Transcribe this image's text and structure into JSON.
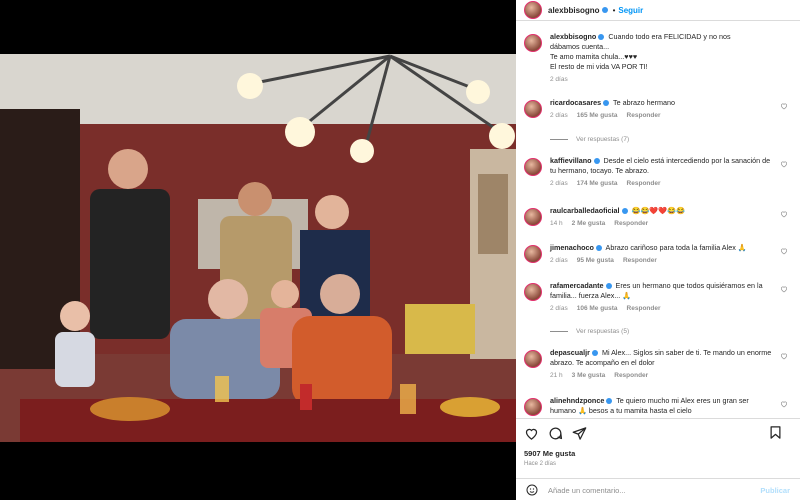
{
  "post": {
    "username": "alexbbisogno",
    "follow_label": "Seguir",
    "separator": "•"
  },
  "caption": {
    "username": "alexbbisogno",
    "text_1": "Cuando todo era FELICIDAD y no nos",
    "text_2": "dábamos cuenta...",
    "text_3": "Te amo mamita chula...♥♥♥",
    "text_4": "El resto de mi vida VA POR TI!",
    "time": "2 días"
  },
  "comments": [
    {
      "username": "ricardocasares",
      "text": "Te abrazo hermano",
      "time": "2 días",
      "likes": "165 Me gusta",
      "reply": "Responder",
      "replies": "Ver respuestas (7)"
    },
    {
      "username": "kaffievillano",
      "text": "Desde el cielo está intercediendo por la sanación de tu hermano, tocayo. Te abrazo.",
      "time": "2 días",
      "likes": "174 Me gusta",
      "reply": "Responder",
      "replies": ""
    },
    {
      "username": "raulcarballedaoficial",
      "text": "😂😂❤️❤️😂😂",
      "time": "14 h",
      "likes": "2 Me gusta",
      "reply": "Responder",
      "replies": ""
    },
    {
      "username": "jimenachoco",
      "text": "Abrazo cariñoso para toda la familia Alex 🙏",
      "time": "2 días",
      "likes": "95 Me gusta",
      "reply": "Responder",
      "replies": ""
    },
    {
      "username": "rafamercadante",
      "text": "Eres un hermano que todos quisiéramos en la familia... fuerza Alex... 🙏",
      "time": "2 días",
      "likes": "106 Me gusta",
      "reply": "Responder",
      "replies": "Ver respuestas (5)"
    },
    {
      "username": "depascualjr",
      "text": "Mi Alex... Siglos sin saber de ti. Te mando un enorme abrazo. Te acompaño en el dolor",
      "time": "21 h",
      "likes": "3 Me gusta",
      "reply": "Responder",
      "replies": ""
    },
    {
      "username": "alinehndzponce",
      "text": "Te quiero mucho mi Alex eres un gran ser humano 🙏 besos a tu mamita hasta el cielo",
      "time": "",
      "likes": "",
      "reply": "",
      "replies": ""
    }
  ],
  "footer": {
    "likes": "5907 Me gusta",
    "ago": "Hace 2 días",
    "add_comment_placeholder": "Añade un comentario...",
    "publish": "Publicar"
  },
  "icons": {
    "heart": "heart-icon",
    "comment": "comment-icon",
    "share": "share-icon",
    "save": "bookmark-icon",
    "emoji": "emoji-icon"
  },
  "colors": {
    "link_blue": "#0095f6",
    "verified_blue": "#3897f0",
    "muted": "#8e8e8e",
    "wall_red": "#7a3a34"
  }
}
